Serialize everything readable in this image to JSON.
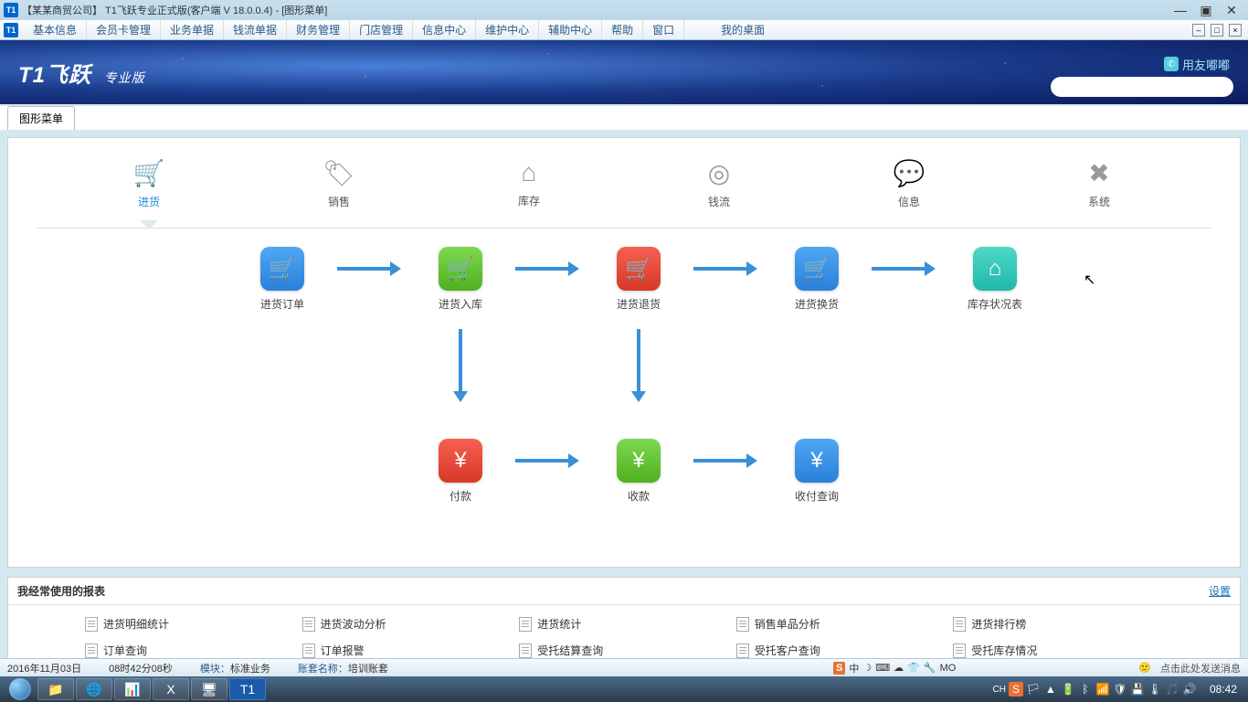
{
  "title": "【某某商贸公司】 T1飞跃专业正式版(客户端 V 18.0.0.4) - [图形菜单]",
  "menu": [
    "基本信息",
    "会员卡管理",
    "业务单据",
    "钱流单据",
    "财务管理",
    "门店管理",
    "信息中心",
    "维护中心",
    "辅助中心",
    "帮助",
    "窗口"
  ],
  "menu_right": "我的桌面",
  "logo": "T1飞跃",
  "logo_sub": "专业版",
  "yylink": "用友嘟嘟",
  "tab": "图形菜单",
  "cats": [
    {
      "label": "进货",
      "icon": "🛒",
      "active": true
    },
    {
      "label": "销售",
      "icon": "🏷",
      "active": false
    },
    {
      "label": "库存",
      "icon": "⌂",
      "active": false
    },
    {
      "label": "钱流",
      "icon": "◎",
      "active": false
    },
    {
      "label": "信息",
      "icon": "💬",
      "active": false
    },
    {
      "label": "系统",
      "icon": "✖",
      "active": false
    }
  ],
  "nodes": {
    "r1": [
      {
        "label": "进货订单",
        "cls": "blue",
        "icon": "🛒"
      },
      {
        "label": "进货入库",
        "cls": "green",
        "icon": "🛒"
      },
      {
        "label": "进货退货",
        "cls": "red",
        "icon": "🛒"
      },
      {
        "label": "进货换货",
        "cls": "blue",
        "icon": "🛒"
      },
      {
        "label": "库存状况表",
        "cls": "teal",
        "icon": "⌂"
      }
    ],
    "r2": [
      {
        "label": "付款",
        "cls": "red",
        "icon": "¥"
      },
      {
        "label": "收款",
        "cls": "green",
        "icon": "¥"
      },
      {
        "label": "收付查询",
        "cls": "blue",
        "icon": "¥"
      }
    ]
  },
  "reports": {
    "title": "我经常使用的报表",
    "settings": "设置",
    "links": [
      "进货明细统计",
      "进货波动分析",
      "进货统计",
      "销售单品分析",
      "进货排行榜",
      "订单查询",
      "订单报警",
      "受托结算查询",
      "受托客户查询",
      "受托库存情况"
    ]
  },
  "status": {
    "date": "2016年11月03日",
    "time": "08时42分08秒",
    "module_lbl": "模块：",
    "module": "标准业务",
    "acct_lbl": "账套名称：",
    "acct": "培训账套",
    "demo": "MO",
    "msg": "点击此处发送消息",
    "ime": "中"
  },
  "taskbar": {
    "clock": "08:42",
    "lang": "CH"
  }
}
